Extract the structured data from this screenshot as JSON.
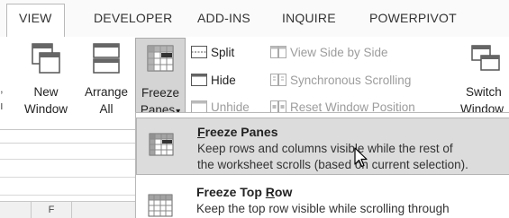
{
  "tabs": [
    {
      "label": "VIEW",
      "active": true
    },
    {
      "label": "DEVELOPER",
      "active": false
    },
    {
      "label": "ADD-INS",
      "active": false
    },
    {
      "label": "INQUIRE",
      "active": false
    },
    {
      "label": "POWERPIVOT",
      "active": false
    }
  ],
  "ribbon": {
    "left_sliver": [
      ",",
      "ı"
    ],
    "new_window": {
      "line1": "New",
      "line2": "Window",
      "icon": "new-window-icon"
    },
    "arrange_all": {
      "line1": "Arrange",
      "line2": "All",
      "icon": "arrange-all-icon"
    },
    "freeze_panes": {
      "line1": "Freeze",
      "line2": "Panes",
      "dropdown_arrow": "▾",
      "icon": "freeze-panes-icon"
    },
    "split": {
      "label": "Split",
      "icon": "split-icon"
    },
    "hide": {
      "label": "Hide",
      "icon": "hide-icon"
    },
    "unhide": {
      "label": "Unhide",
      "icon": "unhide-icon"
    },
    "view_side_by_side": {
      "label": "View Side by Side",
      "icon": "view-side-by-side-icon"
    },
    "synchronous_scrolling": {
      "label": "Synchronous Scrolling",
      "icon": "synchronous-scrolling-icon"
    },
    "reset_window_position": {
      "label": "Reset Window Position",
      "icon": "reset-window-position-icon"
    },
    "switch_windows": {
      "line1": "Switch",
      "line2": "Window",
      "icon": "switch-windows-icon"
    }
  },
  "sheet": {
    "column_header": "F"
  },
  "menu": {
    "items": [
      {
        "title_accel": "F",
        "title_rest": "reeze Panes",
        "desc_line1": "Keep rows and columns visible while the rest of",
        "desc_line2": "the worksheet scrolls (based on current selection).",
        "icon": "freeze-panes-icon",
        "hovered": true
      },
      {
        "title_before": "Freeze Top ",
        "title_accel": "R",
        "title_after": "ow",
        "desc_line1": "Keep the top row visible while scrolling through",
        "icon": "freeze-top-row-icon",
        "hovered": false
      }
    ]
  },
  "colors": {
    "pressed_bg": "#d4d4d4",
    "hover_bg": "#dcdcdc",
    "disabled_text": "#9c9c9c",
    "ribbon_bg": "#ffffff",
    "tabbar_bg": "#fafafa"
  }
}
